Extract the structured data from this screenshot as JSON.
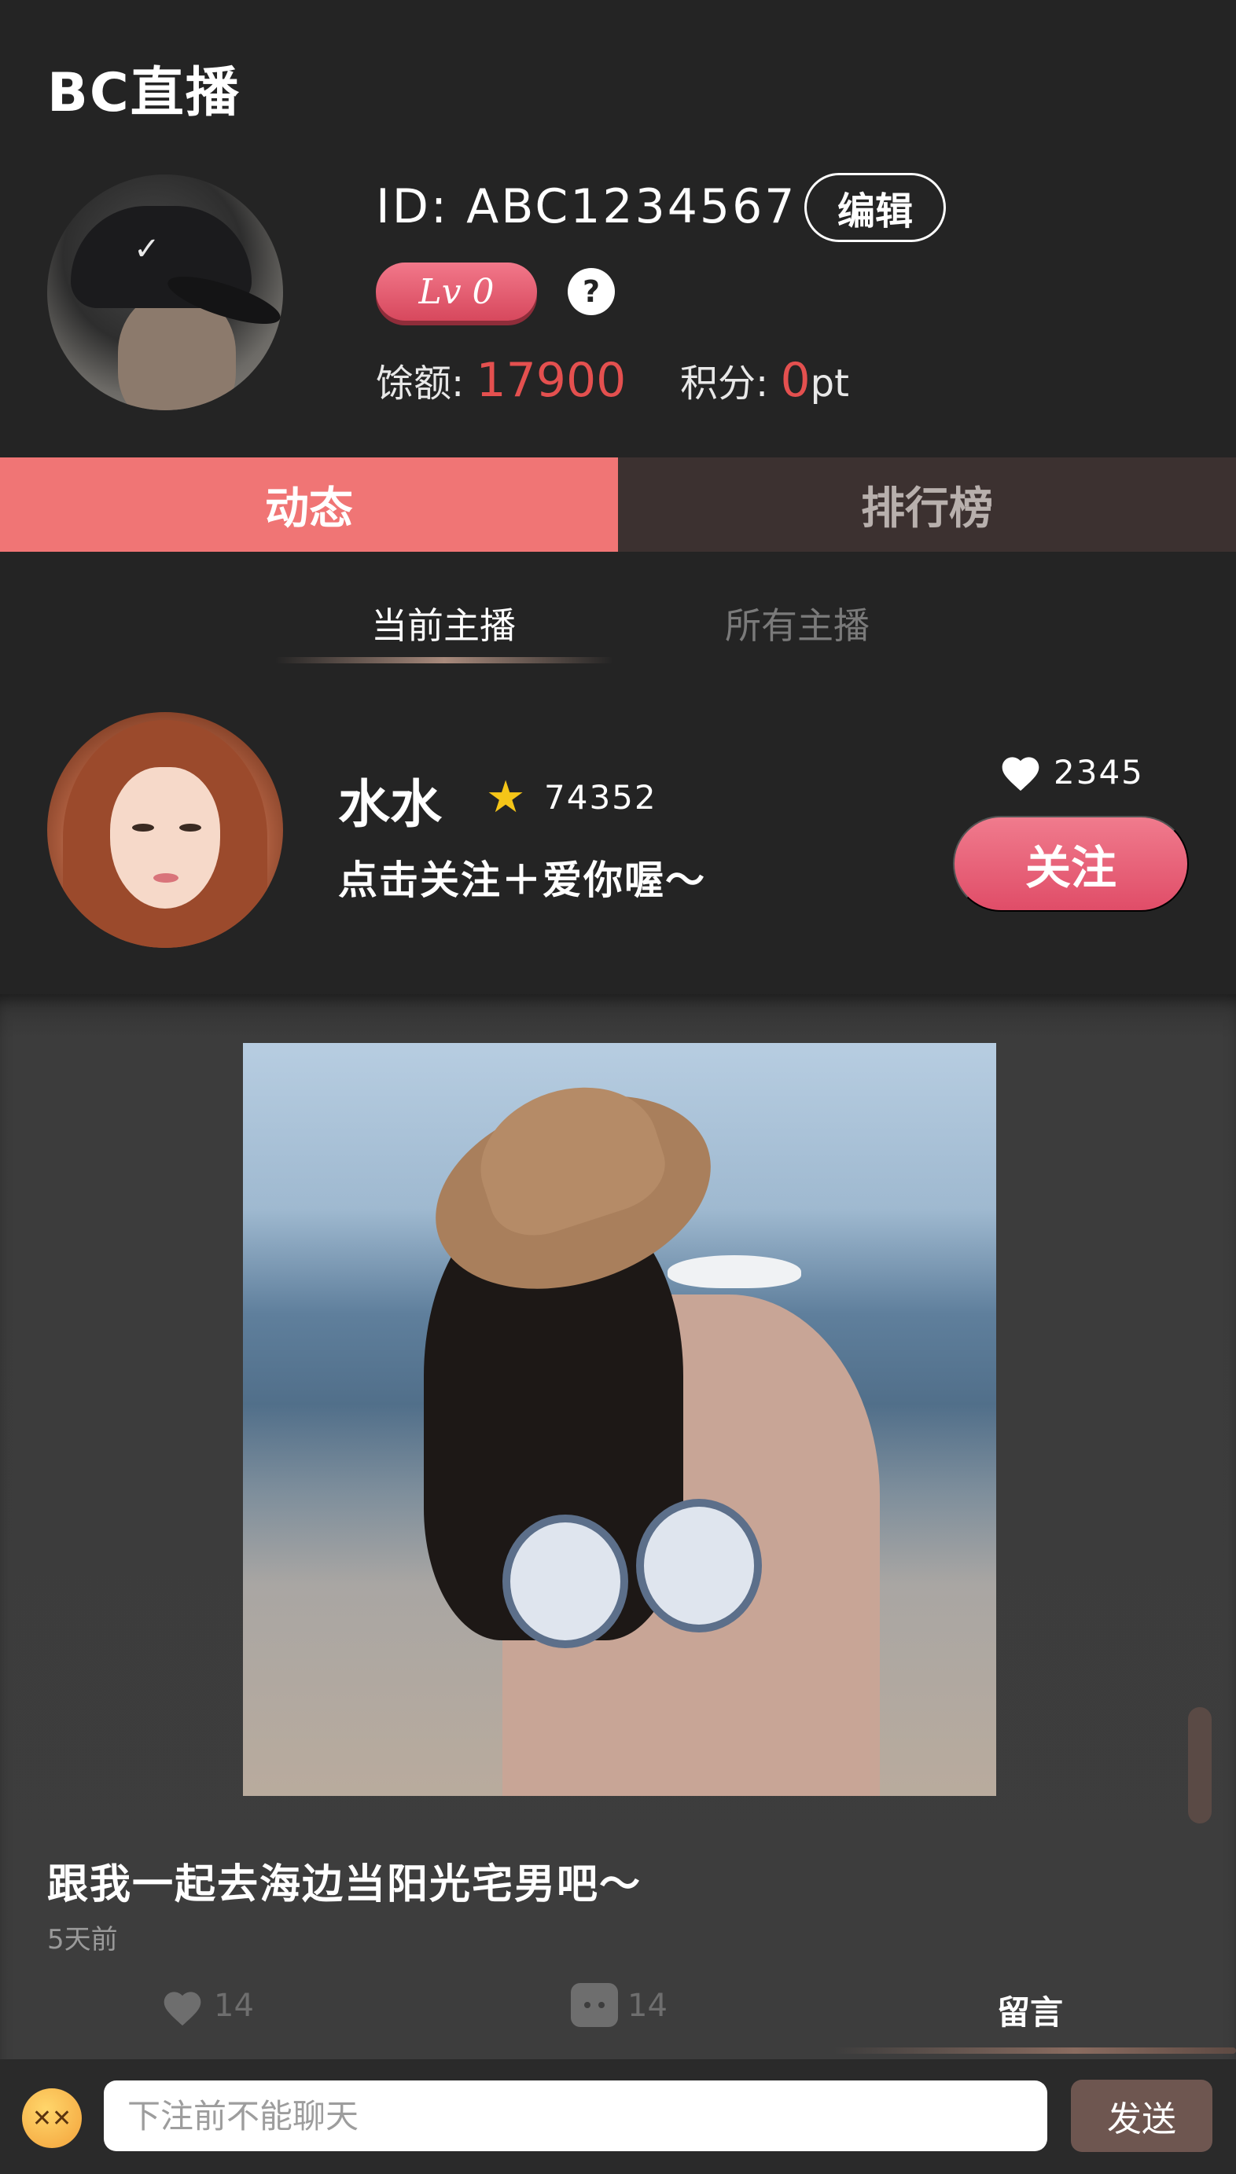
{
  "app": {
    "title": "BC直播"
  },
  "profile": {
    "id_text": "ID: ABC1234567",
    "edit_label": "编辑",
    "level": "Lv 0",
    "help_symbol": "?",
    "balance_label": "馀额: ",
    "balance_value": "17900",
    "points_label": "积分: ",
    "points_value": "0",
    "points_unit": "pt"
  },
  "main_tabs": [
    {
      "label": "动态",
      "active": true
    },
    {
      "label": "排行榜",
      "active": false
    }
  ],
  "sub_tabs": [
    {
      "label": "当前主播",
      "active": true
    },
    {
      "label": "所有主播",
      "active": false
    }
  ],
  "streamer": {
    "name": "水水",
    "stars": "74352",
    "slogan": "点击关注＋爱你喔～",
    "likes": "2345",
    "follow_label": "关注"
  },
  "post": {
    "caption": "跟我一起去海边当阳光宅男吧～",
    "time": "5天前",
    "like_count": "14",
    "comment_count": "14",
    "reply_label": "留言"
  },
  "chat": {
    "placeholder": "下注前不能聊天",
    "send_label": "发送"
  },
  "colors": {
    "accent": "#f07575",
    "value_red": "#e4504f",
    "star": "#f5c518",
    "background": "#242424"
  }
}
